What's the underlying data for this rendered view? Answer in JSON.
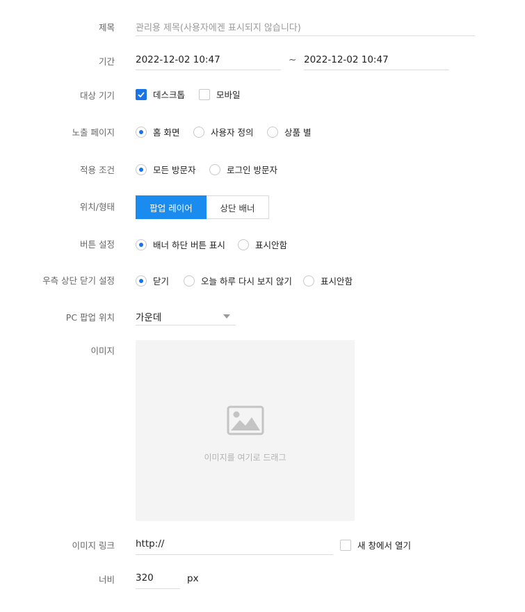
{
  "title_row": {
    "label": "제목",
    "placeholder": "관리용 제목(사용자에겐 표시되지 않습니다)"
  },
  "period_row": {
    "label": "기간",
    "start": "2022-12-02 10:47",
    "separator": "~",
    "end": "2022-12-02 10:47"
  },
  "device_row": {
    "label": "대상 기기",
    "options": [
      {
        "label": "데스크톱",
        "checked": true
      },
      {
        "label": "모바일",
        "checked": false
      }
    ]
  },
  "page_row": {
    "label": "노출 페이지",
    "options": [
      {
        "label": "홈 화면",
        "selected": true
      },
      {
        "label": "사용자 정의",
        "selected": false
      },
      {
        "label": "상품 별",
        "selected": false
      }
    ]
  },
  "condition_row": {
    "label": "적용 조건",
    "options": [
      {
        "label": "모든 방문자",
        "selected": true
      },
      {
        "label": "로그인 방문자",
        "selected": false
      }
    ]
  },
  "position_row": {
    "label": "위치/형태",
    "segments": [
      {
        "label": "팝업 레이어",
        "active": true
      },
      {
        "label": "상단 배너",
        "active": false
      }
    ]
  },
  "button_row": {
    "label": "버튼 설정",
    "options": [
      {
        "label": "배너 하단 버튼 표시",
        "selected": true
      },
      {
        "label": "표시안함",
        "selected": false
      }
    ]
  },
  "close_row": {
    "label": "우측 상단 닫기 설정",
    "options": [
      {
        "label": "닫기",
        "selected": true
      },
      {
        "label": "오늘 하루 다시 보지 않기",
        "selected": false
      },
      {
        "label": "표시안함",
        "selected": false
      }
    ]
  },
  "pc_position_row": {
    "label": "PC 팝업 위치",
    "value": "가운데"
  },
  "image_row": {
    "label": "이미지",
    "drop_text": "이미지를 여기로 드래그"
  },
  "link_row": {
    "label": "이미지 링크",
    "value": "http://",
    "new_window_label": "새 창에서 열기",
    "new_window_checked": false
  },
  "width_row": {
    "label": "너비",
    "value": "320",
    "unit": "px"
  },
  "colors": {
    "accent": "#1a73e8",
    "segment_active": "#1a8cf0"
  }
}
